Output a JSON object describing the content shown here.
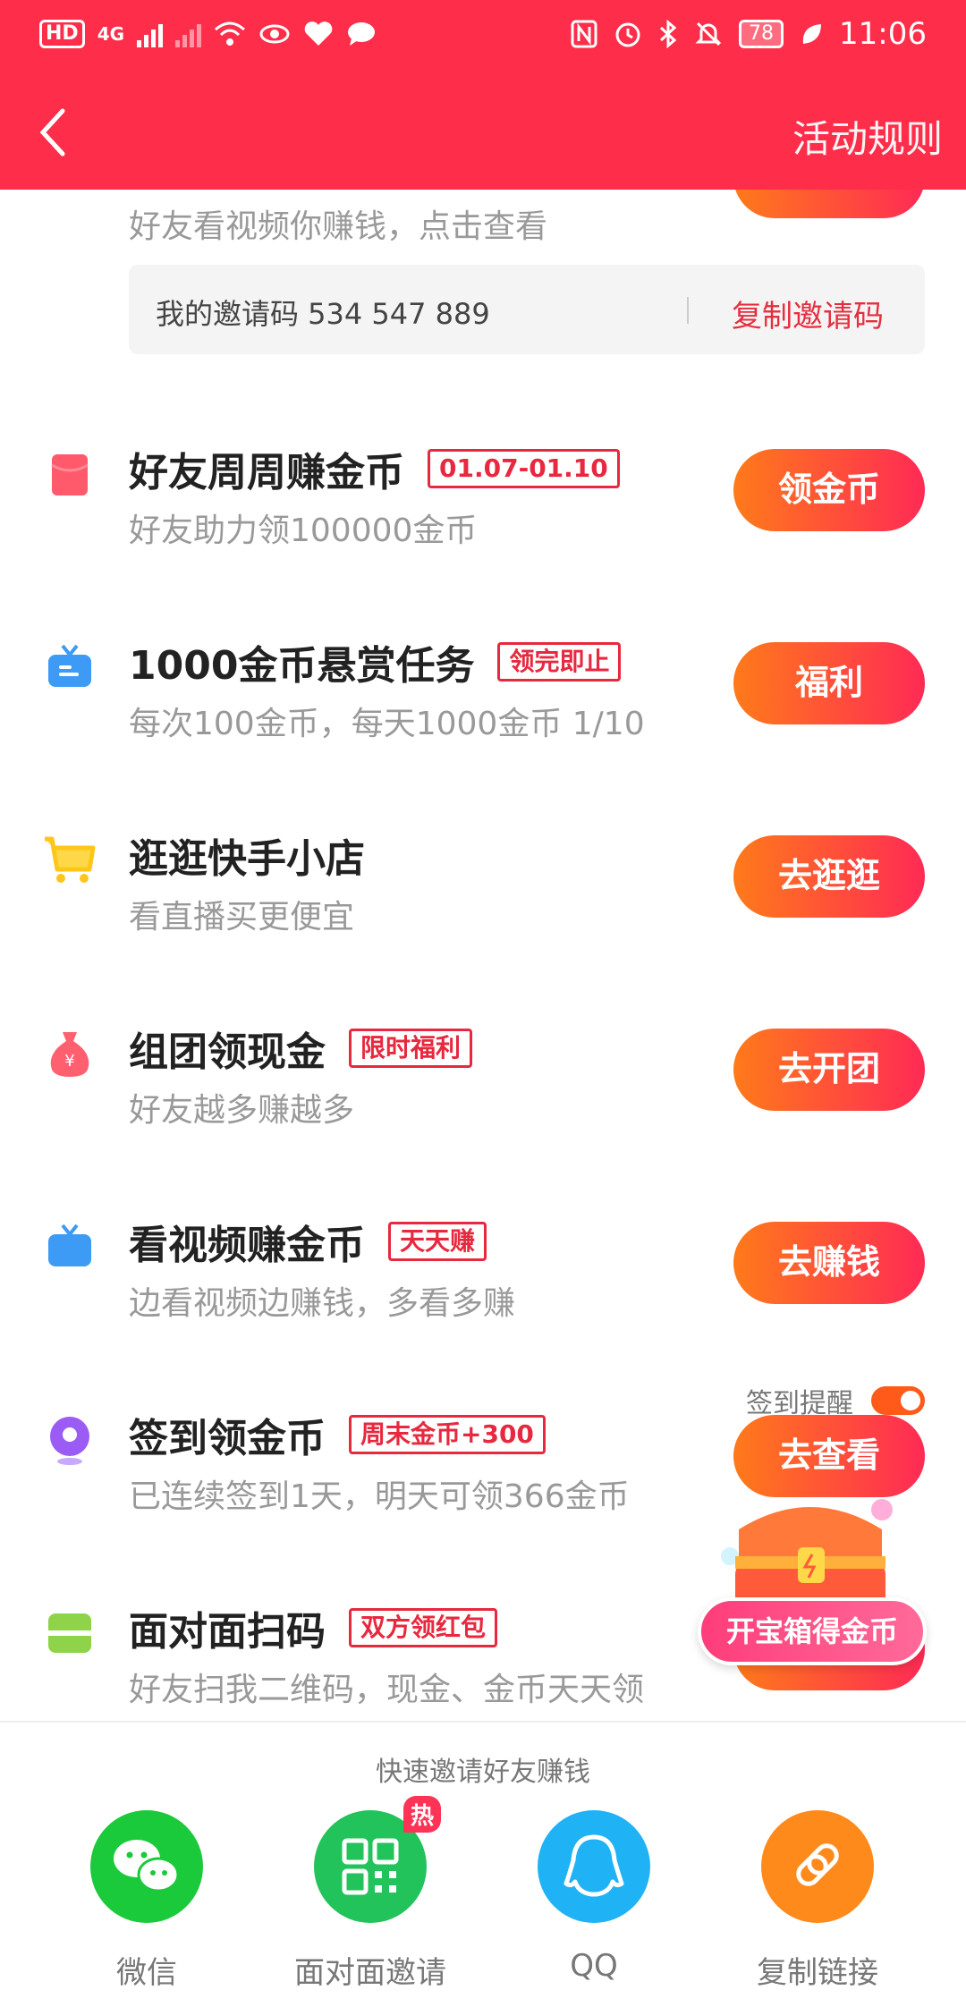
{
  "status_bar": {
    "hd": "HD",
    "network": "4G",
    "battery": "78",
    "time": "11:06"
  },
  "header": {
    "rules_label": "活动规则"
  },
  "invite": {
    "partial_subtitle": "好友看视频你赚钱，点击查看",
    "code_text": "我的邀请码 534 547 889",
    "copy_label": "复制邀请码"
  },
  "tasks": [
    {
      "title": "好友周周赚金币",
      "tag": "01.07-01.10",
      "subtitle": "好友助力领100000金币",
      "button": "领金币",
      "icon": "red-envelope-icon"
    },
    {
      "title": "1000金币悬赏任务",
      "tag": "领完即止",
      "subtitle": "每次100金币，每天1000金币 1/10",
      "button": "福利",
      "icon": "tv-icon"
    },
    {
      "title": "逛逛快手小店",
      "tag": "",
      "subtitle": "看直播买更便宜",
      "button": "去逛逛",
      "icon": "shopping-cart-icon"
    },
    {
      "title": "组团领现金",
      "tag": "限时福利",
      "subtitle": "好友越多赚越多",
      "button": "去开团",
      "icon": "money-bag-icon"
    },
    {
      "title": "看视频赚金币",
      "tag": "天天赚",
      "subtitle": "边看视频边赚钱，多看多赚",
      "button": "去赚钱",
      "icon": "tv-icon"
    },
    {
      "title": "签到领金币",
      "tag": "周末金币+300",
      "subtitle": "已连续签到1天，明天可领366金币",
      "button": "去查看",
      "icon": "location-pin-icon"
    },
    {
      "title": "面对面扫码",
      "tag": "双方领红包",
      "subtitle": "好友扫我二维码，现金、金币天天领",
      "button": "",
      "icon": "scan-icon"
    }
  ],
  "remind": {
    "label": "签到提醒",
    "enabled": true
  },
  "chest": {
    "label": "开宝箱得金币"
  },
  "share": {
    "title": "快速邀请好友赚钱",
    "items": [
      {
        "label": "微信",
        "color": "#1aca3a"
      },
      {
        "label": "面对面邀请",
        "color": "#21c35a",
        "badge": "热"
      },
      {
        "label": "QQ",
        "color": "#1fb2f5"
      },
      {
        "label": "复制链接",
        "color": "#ff8a1c"
      }
    ]
  },
  "colors": {
    "header": "#fe2d4a",
    "accent": "#e8283e",
    "button_from": "#ff7a1a",
    "button_to": "#ff2a55"
  }
}
